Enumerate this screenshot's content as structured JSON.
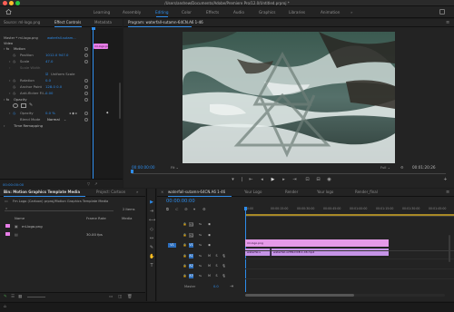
{
  "window": {
    "title": "/Users/andrew/Documents/Adobe/Premiere Pro/12.0/Untitled.prproj *"
  },
  "workspaces": {
    "items": [
      "Learning",
      "Assembly",
      "Editing",
      "Color",
      "Effects",
      "Audio",
      "Graphics",
      "Libraries",
      "Animation"
    ],
    "active": "Editing",
    "accent": "#2d8ceb"
  },
  "effect_controls": {
    "tabs": [
      "Source: ml-logo.png",
      "Effect Controls",
      "Metadata"
    ],
    "active_tab": "Effect Controls",
    "source_label": "Master * ml-logo.png",
    "clip_label": "waterfall-sutam...",
    "clip_time": "00:00",
    "clip_name": "ml-logo.png",
    "section_video": "Video",
    "rows": [
      {
        "label": "Motion",
        "value": "",
        "indent": 1
      },
      {
        "label": "Position",
        "value": "1012.0   947.0",
        "indent": 2
      },
      {
        "label": "Scale",
        "value": "47.0",
        "indent": 2
      },
      {
        "label": "Scale Width",
        "value": "",
        "indent": 2
      },
      {
        "label": "Uniform Scale",
        "value": "",
        "indent": 3
      },
      {
        "label": "Rotation",
        "value": "0.0",
        "indent": 2
      },
      {
        "label": "Anchor Point",
        "value": "128.0   0.0",
        "indent": 2
      },
      {
        "label": "Anti-flicker Fil...",
        "value": "0.00",
        "indent": 2
      },
      {
        "label": "Opacity",
        "value": "",
        "indent": 1
      },
      {
        "label": "Opacity",
        "value": "0.0 %",
        "indent": 2
      },
      {
        "label": "Blend Mode",
        "value": "Normal",
        "indent": 2
      },
      {
        "label": "Time Remapping",
        "value": "",
        "indent": 1
      }
    ],
    "timecode": "00:00:00:00"
  },
  "program_monitor": {
    "title": "Program: waterfall-sutamn-64CN.A6 1-46",
    "timecode": "00:00:00:00",
    "fit": "Fit",
    "resolution": "Full",
    "duration": "00:01:20:26"
  },
  "project": {
    "tabs": [
      "Bin: Motion Graphics Template Media",
      "Project: Cartoon"
    ],
    "active_tab": "Bin: Motion Graphics Template Media",
    "path": "Fm Logo (Cartoon) prproj/Motion Graphics Template Media",
    "item_count": "2 Items",
    "columns": [
      "Name",
      "Frame Rate",
      "Media"
    ],
    "items": [
      {
        "name": "ml-logo.png",
        "rate": "",
        "color": "#e87ee8"
      },
      {
        "name": "",
        "rate": "30.00 fps",
        "color": "#e87ee8"
      }
    ]
  },
  "timeline": {
    "tabs": [
      "waterfall-sutamn-64CN.A6 1-46",
      "Your Logo",
      "Render",
      "Your logo",
      "Render_final"
    ],
    "active_tab": "waterfall-sutamn-64CN.A6 1-46",
    "timecode": "00:00:00:00",
    "ruler": [
      "00:00",
      "00:00:15:00",
      "00:00:30:00",
      "00:00:45:00",
      "00:01:00:00",
      "00:01:15:00",
      "00:01:30:00",
      "00:01:45:00"
    ],
    "tracks_video": [
      "V3",
      "V2",
      "V1"
    ],
    "tracks_audio": [
      "A1",
      "A2",
      "A3"
    ],
    "source_patch": "V1",
    "master_label": "Master",
    "master_value": "0.0",
    "clips": {
      "v2": "ml-logo.png",
      "v1": [
        "waterfal-s",
        "waterfall-sVHN-DCB.1-46.mp4"
      ],
      "clip_color": "#d48ae8"
    }
  }
}
